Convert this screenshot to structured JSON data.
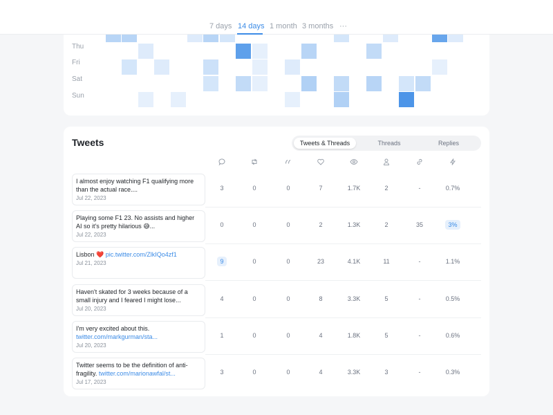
{
  "range": {
    "tabs": [
      "7 days",
      "14 days",
      "1 month",
      "3 months"
    ],
    "active": "14 days",
    "more": "···"
  },
  "heatmap": {
    "days": [
      "Thu",
      "Fri",
      "Sat",
      "Sun"
    ],
    "max_label": "",
    "cells_intensity": {
      "top_partial": [
        0,
        0.3,
        0.3,
        0,
        0,
        0,
        0.1,
        0.3,
        0.15,
        0,
        0,
        0,
        0,
        0,
        0,
        0.15,
        0,
        0,
        0.1,
        0,
        0,
        0.75,
        0.1,
        0
      ],
      "Thu": [
        0,
        0,
        0,
        0.1,
        0,
        0,
        0,
        0,
        0,
        0.8,
        0.05,
        0,
        0,
        0.3,
        0,
        0,
        0,
        0.25,
        0,
        0,
        0,
        0,
        0,
        0
      ],
      "Fri": [
        0,
        0,
        0.15,
        0,
        0.1,
        0,
        0,
        0.2,
        0,
        0,
        0.05,
        0,
        0.1,
        0,
        0,
        0,
        0,
        0,
        0,
        0,
        0,
        0.05,
        0,
        0
      ],
      "Sat": [
        0,
        0,
        0,
        0,
        0,
        0,
        0,
        0.15,
        0,
        0.25,
        0.05,
        0,
        0,
        0.35,
        0,
        0.25,
        0,
        0.3,
        0,
        0.15,
        0.25,
        0,
        0,
        0
      ],
      "Sun": [
        0,
        0,
        0,
        0.05,
        0,
        0.05,
        0,
        0,
        0,
        0,
        0,
        0,
        0.05,
        0,
        0,
        0.35,
        0,
        0,
        0,
        0.9,
        0,
        0,
        0,
        0
      ]
    },
    "color": "#3b8be6"
  },
  "tweets": {
    "title": "Tweets",
    "filters": [
      "Tweets & Threads",
      "Threads",
      "Replies"
    ],
    "active_filter": "Tweets & Threads",
    "columns": [
      "reply-icon",
      "retweet-icon",
      "quote-icon",
      "like-icon",
      "views-icon",
      "profile-icon",
      "link-icon",
      "engagement-icon"
    ],
    "rows": [
      {
        "text": "I almost enjoy watching F1 qualifying more than the actual race....",
        "link": "",
        "date": "Jul 22, 2023",
        "metrics": [
          "3",
          "0",
          "0",
          "7",
          "1.7K",
          "2",
          "-",
          "0.7%"
        ],
        "highlight": []
      },
      {
        "text": "Playing some F1 23. No assists and higher AI so it's pretty hilarious 😅...",
        "link": "",
        "date": "Jul 22, 2023",
        "metrics": [
          "0",
          "0",
          "0",
          "2",
          "1.3K",
          "2",
          "35",
          "3%"
        ],
        "highlight": [
          7
        ]
      },
      {
        "text": "Lisbon ❤️ ",
        "link": "pic.twitter.com/ZlkIQo4zf1",
        "date": "Jul 21, 2023",
        "metrics": [
          "9",
          "0",
          "0",
          "23",
          "4.1K",
          "11",
          "-",
          "1.1%"
        ],
        "highlight": [
          0
        ]
      },
      {
        "text": "Haven't skated for 3 weeks because of a small injury and I feared I might lose...",
        "link": "",
        "date": "Jul 20, 2023",
        "metrics": [
          "4",
          "0",
          "0",
          "8",
          "3.3K",
          "5",
          "-",
          "0.5%"
        ],
        "highlight": []
      },
      {
        "text": "I'm very excited about this. ",
        "link": "twitter.com/markgurman/sta...",
        "date": "Jul 20, 2023",
        "metrics": [
          "1",
          "0",
          "0",
          "4",
          "1.8K",
          "5",
          "-",
          "0.6%"
        ],
        "highlight": []
      },
      {
        "text": "Twitter seems to be the definition of anti-fragility. ",
        "link": "twitter.com/marionawfal/st...",
        "date": "Jul 17, 2023",
        "metrics": [
          "3",
          "0",
          "0",
          "4",
          "3.3K",
          "3",
          "-",
          "0.3%"
        ],
        "highlight": []
      }
    ]
  }
}
